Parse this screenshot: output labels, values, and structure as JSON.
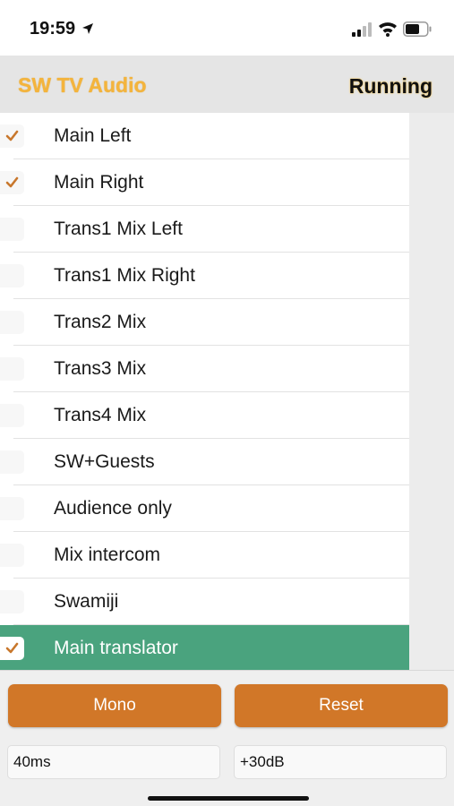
{
  "status_bar": {
    "time": "19:59",
    "icons": [
      "location-arrow-icon",
      "cellular-signal-icon",
      "wifi-icon",
      "battery-icon"
    ]
  },
  "header": {
    "title": "SW TV Audio",
    "status": "Running"
  },
  "channels": [
    {
      "label": "Main Left",
      "checked": true,
      "selected": false
    },
    {
      "label": "Main Right",
      "checked": true,
      "selected": false
    },
    {
      "label": "Trans1 Mix Left",
      "checked": false,
      "selected": false
    },
    {
      "label": "Trans1 Mix Right",
      "checked": false,
      "selected": false
    },
    {
      "label": "Trans2 Mix",
      "checked": false,
      "selected": false
    },
    {
      "label": "Trans3 Mix",
      "checked": false,
      "selected": false
    },
    {
      "label": "Trans4 Mix",
      "checked": false,
      "selected": false
    },
    {
      "label": "SW+Guests",
      "checked": false,
      "selected": false
    },
    {
      "label": "Audience only",
      "checked": false,
      "selected": false
    },
    {
      "label": "Mix intercom",
      "checked": false,
      "selected": false
    },
    {
      "label": "Swamiji",
      "checked": false,
      "selected": false
    },
    {
      "label": "Main translator",
      "checked": true,
      "selected": true
    }
  ],
  "controls": {
    "mono_label": "Mono",
    "reset_label": "Reset",
    "delay_value": "40ms",
    "gain_value": "+30dB"
  },
  "colors": {
    "title": "#f4b43c",
    "check": "#c8772c",
    "selected_row": "#4aa37e",
    "button": "#d17728"
  }
}
